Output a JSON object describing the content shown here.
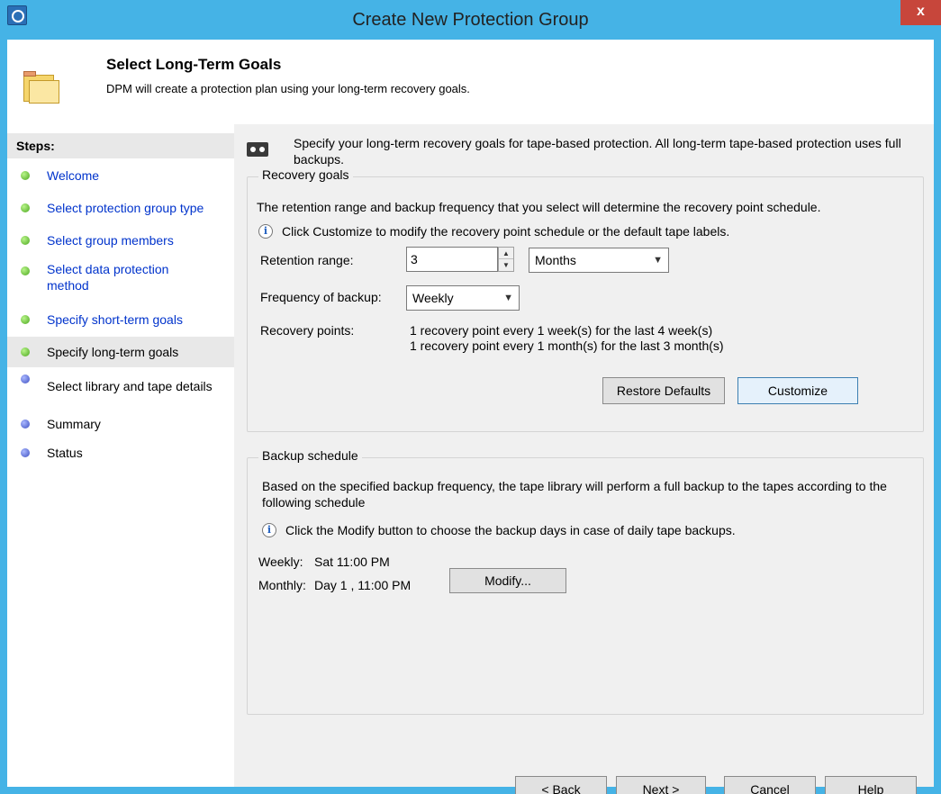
{
  "window": {
    "title": "Create New Protection Group",
    "close_glyph": "x"
  },
  "header": {
    "title": "Select Long-Term Goals",
    "subtitle": "DPM will create a protection plan using your long-term recovery goals."
  },
  "sidebar": {
    "heading": "Steps:",
    "items": [
      {
        "label": "Welcome",
        "state": "done"
      },
      {
        "label": "Select protection group type",
        "state": "done"
      },
      {
        "label": "Select group members",
        "state": "done"
      },
      {
        "label": "Select data protection method",
        "state": "done"
      },
      {
        "label": "Specify short-term goals",
        "state": "done"
      },
      {
        "label": "Specify long-term goals",
        "state": "current"
      },
      {
        "label": "Select library and tape details",
        "state": "pending"
      },
      {
        "label": "Summary",
        "state": "pending"
      },
      {
        "label": "Status",
        "state": "pending"
      }
    ]
  },
  "main": {
    "intro": "Specify your long-term recovery goals for tape-based protection. All long-term tape-based protection uses full backups.",
    "recovery": {
      "title": "Recovery goals",
      "description": "The retention range and backup frequency that you select will determine the recovery point schedule.",
      "info": "Click Customize to modify the recovery point schedule or the default tape labels.",
      "retention_label": "Retention range:",
      "retention_value": "3",
      "retention_unit": "Months",
      "frequency_label": "Frequency of backup:",
      "frequency_value": "Weekly",
      "points_label": "Recovery points:",
      "points_line1": "1 recovery point every 1 week(s) for the last 4 week(s)",
      "points_line2": "1 recovery point every  1 month(s) for the last 3 month(s)",
      "restore_button": "Restore Defaults",
      "customize_button": "Customize"
    },
    "backup": {
      "title": "Backup schedule",
      "description": "Based on the specified backup frequency, the tape library will perform a full backup to the tapes according to the following schedule",
      "info": "Click the Modify button to choose the backup days in case of daily tape backups.",
      "weekly_label": "Weekly:",
      "weekly_value": "Sat 11:00 PM",
      "monthly_label": "Monthly:",
      "monthly_value": "Day 1 , 11:00 PM",
      "modify_button": "Modify..."
    }
  },
  "footer": {
    "back": "< Back",
    "next": "Next >",
    "cancel": "Cancel",
    "help": "Help"
  },
  "icons": {
    "info": "info-icon",
    "spin_up": "▲",
    "spin_down": "▼",
    "chevron": "▼"
  }
}
